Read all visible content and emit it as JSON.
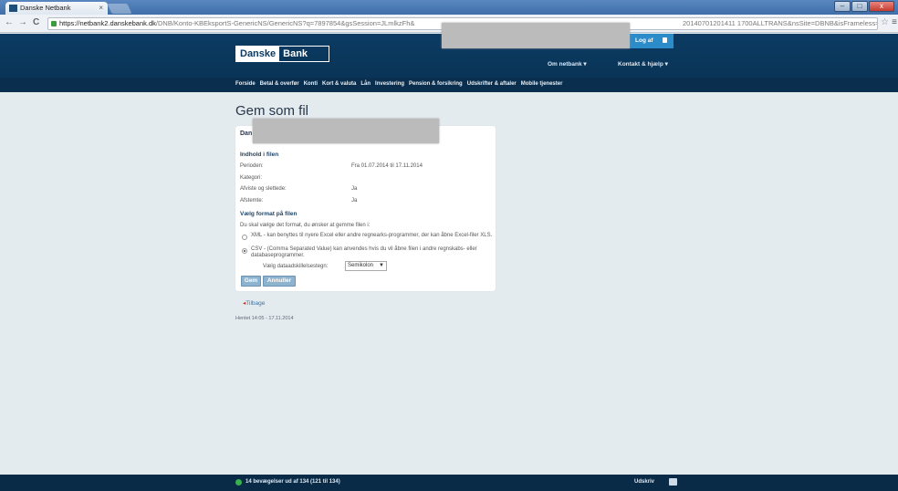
{
  "browser": {
    "tab_title": "Danske Netbank",
    "tab_close": "×",
    "url_host": "https://netbank2.danskebank.dk",
    "url_path": "/DNB/Konto-KBEksportS-GenericNS/GenericNS?q=7897854&gsSession=JLmlkzFh&",
    "url_tail": "20140701201411 1700ALLTRANS&nsSite=DBNB&isFrameless=true",
    "nav_back": "←",
    "nav_forward": "→",
    "nav_reload": "C",
    "star": "☆",
    "menu": "≡",
    "win_min": "–",
    "win_max": "□",
    "win_close": "x"
  },
  "header": {
    "logo_part1": "Danske",
    "logo_part2": "Bank",
    "logoff": "Log af",
    "menu_netbank": "Om netbank ▾",
    "menu_help": "Kontakt & hjælp ▾"
  },
  "nav": {
    "items": [
      "Forside",
      "Betal & overfør",
      "Konti",
      "Kort & valuta",
      "Lån",
      "Investering",
      "Pension & forsikring",
      "Udskrifter & aftaler",
      "Mobile tjenester"
    ]
  },
  "page": {
    "title": "Gem som fil",
    "card_head": "Dan",
    "section_content": "Indhold i filen",
    "period_label": "Perioden:",
    "period_value": "Fra 01.07.2014 til 17.11.2014",
    "category_label": "Kategori:",
    "rejected_label": "Afviste og slettede:",
    "rejected_value": "Ja",
    "stopped_label": "Afstemte:",
    "stopped_value": "Ja",
    "section_format": "Vælg format på filen",
    "format_instruction": "Du skal vælge det format, du ønsker at gemme filen i:",
    "option_xml": "XML - kan benyttes til nyere Excel eller andre regnearks-programmer, der kan åbne Excel-filer XLS.",
    "option_csv": "CSV - (Comma Separated Value) kan anvendes hvis du vil åbne filen i andre regnskabs- eller databaseprogrammer.",
    "separator_label": "Vælg dataadskillelsestegn:",
    "separator_value": "Semikolon",
    "save_button": "Gem",
    "cancel_button": "Annuller",
    "back_link": "Tilbage",
    "back_arrow": "◂",
    "timestamp": "Hentet 14:05 - 17.11.2014"
  },
  "footer": {
    "status": "14 bevægelser ud af 134 (121 til 134)",
    "print": "Udskriv"
  }
}
